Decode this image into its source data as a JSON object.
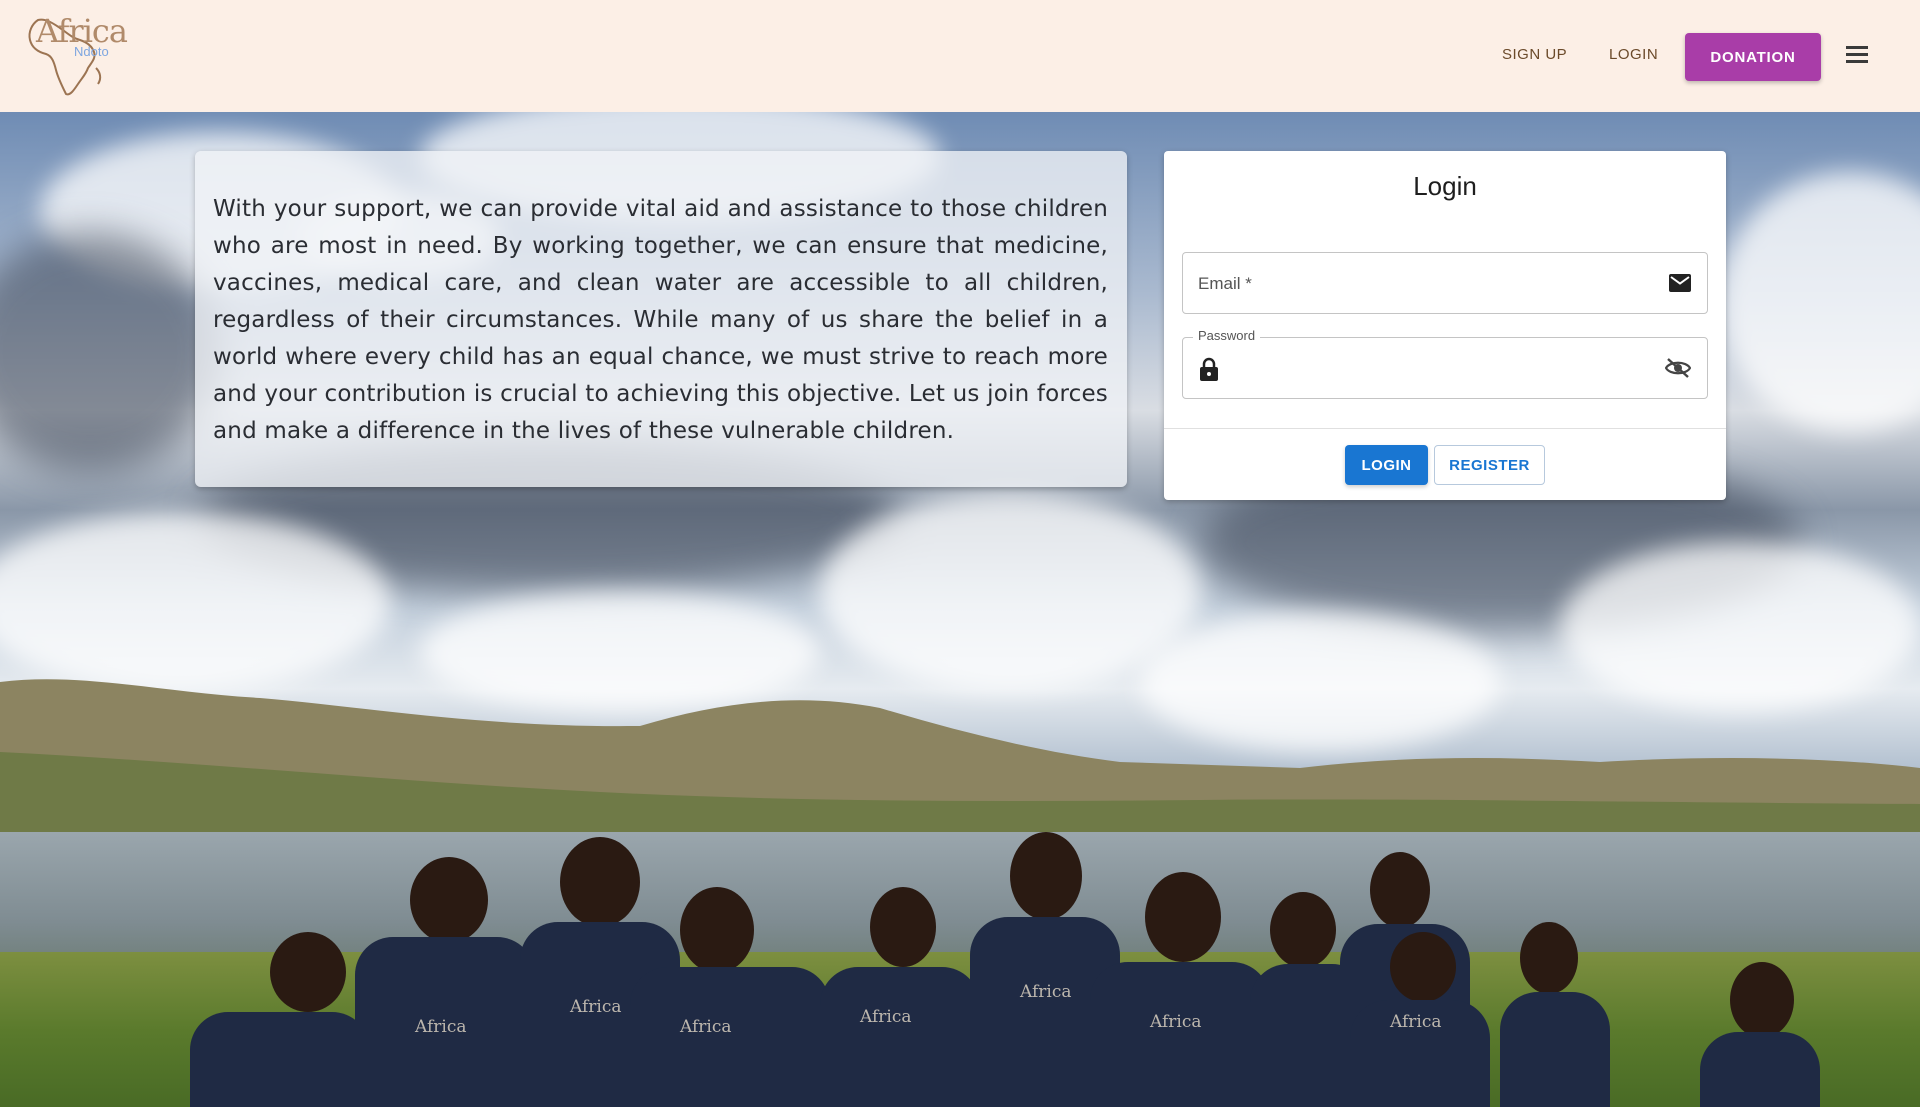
{
  "header": {
    "logo_text": "Africa",
    "logo_subtext": "Ndoto",
    "nav_signup": "SIGN UP",
    "nav_login": "LOGIN",
    "donation_label": "DONATION",
    "menu_icon": "hamburger-menu-icon"
  },
  "info": {
    "text": "With your support, we can provide vital aid and assistance to those children who are most in need. By working together, we can ensure that medicine, vaccines, medical care, and clean water are accessible to all children, regardless of their circumstances. While many of us share the belief in a world where every child has an equal chance, we must strive to reach more and your contribution is crucial to achieving this objective. Let us join forces and make a difference in the lives of these vulnerable children."
  },
  "login": {
    "title": "Login",
    "email_label": "Email *",
    "email_value": "",
    "email_icon": "envelope-icon",
    "password_label": "Password",
    "password_value": "",
    "lock_icon": "lock-icon",
    "visibility_icon": "eye-off-icon",
    "login_button": "LOGIN",
    "register_button": "REGISTER"
  },
  "colors": {
    "header_bg": "#fcefe6",
    "donation_button": "#a93da8",
    "primary": "#1976d2"
  }
}
